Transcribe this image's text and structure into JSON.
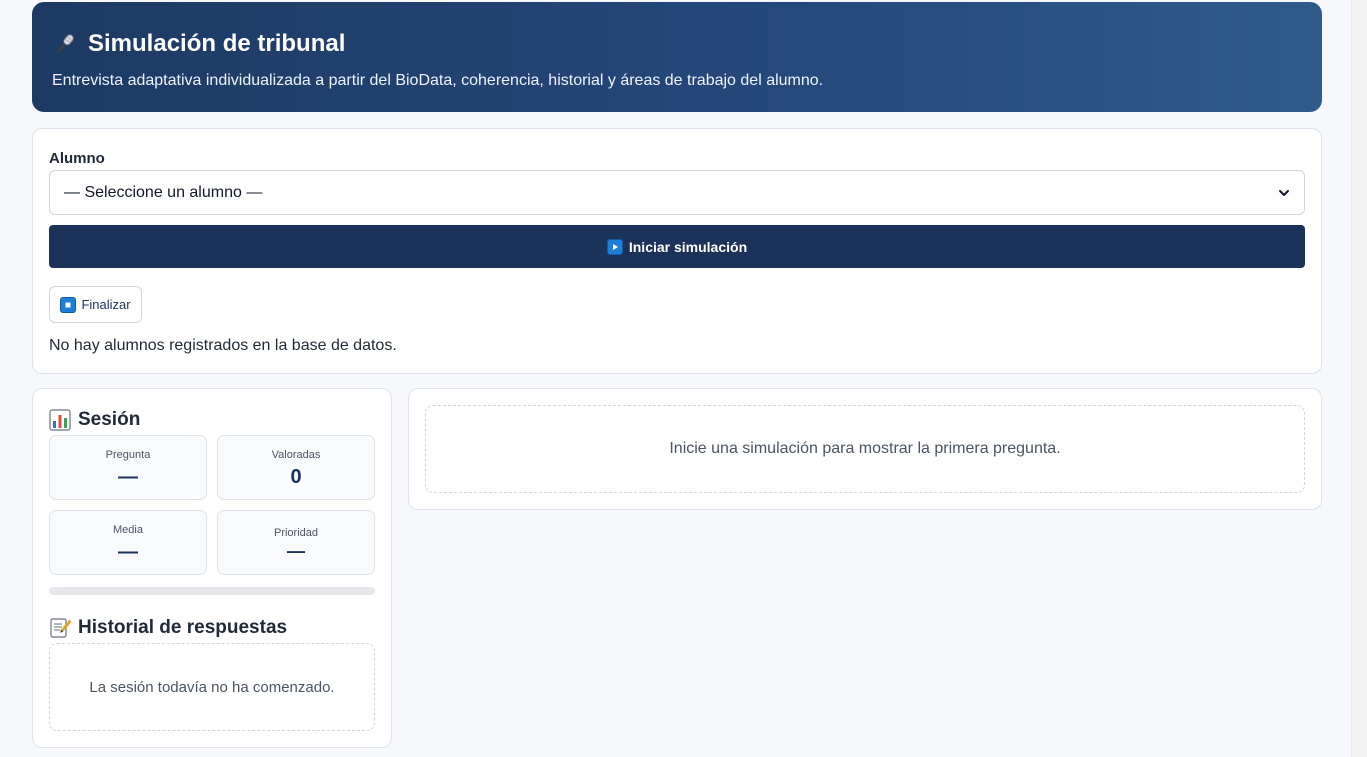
{
  "header": {
    "title": "Simulación de tribunal",
    "subtitle": "Entrevista adaptativa individualizada a partir del BioData, coherencia, historial y áreas de trabajo del alumno.",
    "icon": "microphone-icon"
  },
  "student_form": {
    "label": "Alumno",
    "select_value": "— Seleccione un alumno —",
    "start_label": "Iniciar simulación",
    "finish_label": "Finalizar",
    "empty_message": "No hay alumnos registrados en la base de datos."
  },
  "session": {
    "title": "Sesión",
    "stats": [
      {
        "label": "Pregunta",
        "value": "—"
      },
      {
        "label": "Valoradas",
        "value": "0"
      },
      {
        "label": "Media",
        "value": "—"
      },
      {
        "label": "Prioridad",
        "value": "—"
      }
    ],
    "progress_percent": 0
  },
  "history": {
    "title": "Historial de respuestas",
    "empty_message": "La sesión todavía no ha comenzado."
  },
  "question_panel": {
    "empty_message": "Inicie una simulación para mostrar la primera pregunta."
  },
  "colors": {
    "header_start": "#1c3a63",
    "header_end": "#2e5b8a",
    "primary_button": "#1b325a",
    "icon_blue": "#1e7fd8"
  }
}
